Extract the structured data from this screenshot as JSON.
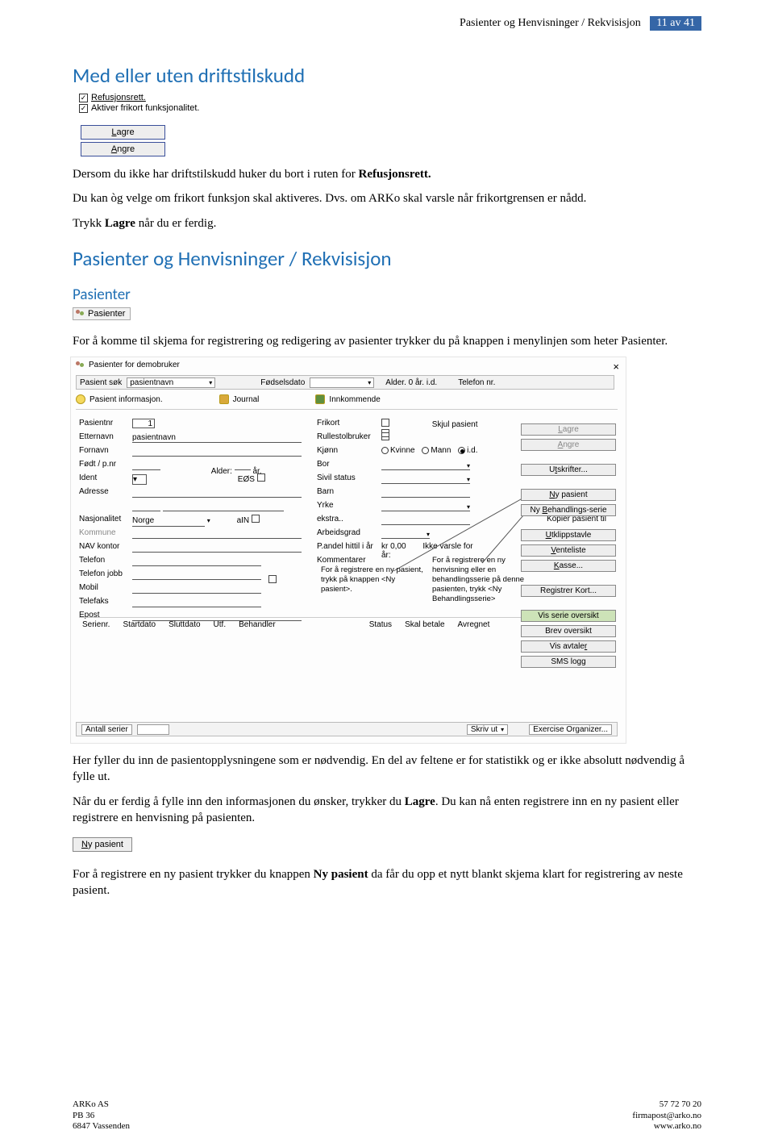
{
  "header": {
    "breadcrumb": "Pasienter og Henvisninger / Rekvisisjon",
    "page_indicator": "11 av 41"
  },
  "h1": "Med eller uten driftstilskudd",
  "checkbox1": {
    "label": "Refusjonsrett."
  },
  "checkbox2": {
    "label": "Aktiver frikort funksjonalitet."
  },
  "btn_lagre": "Lagre",
  "btn_angre": "Angre",
  "p1a": "Dersom du ikke har driftstilskudd huker du bort i ruten for ",
  "p1b": "Refusjonsrett.",
  "p2a": "Du kan òg velge om frikort funksjon skal aktiveres. Dvs. om ARKo skal varsle når frikortgrensen er nådd.",
  "p3a": "Trykk ",
  "p3b": "Lagre",
  "p3c": " når du er ferdig.",
  "h2": "Pasienter og Henvisninger / Rekvisisjon",
  "h3": "Pasienter",
  "chip_pasienter": "Pasienter",
  "p4": "For å komme til skjema for registrering og redigering av pasienter trykker du på knappen i menylinjen som heter Pasienter.",
  "mock": {
    "title": "Pasienter for demobruker",
    "search_label": "Pasient søk",
    "search_combo": "pasientnavn",
    "fodselsdato": "Fødselsdato",
    "alder_hdr": "Alder.  0 år.  i.d.",
    "telefon_hdr": "Telefon nr.",
    "tab_info": "Pasient informasjon.",
    "tab_journal": "Journal",
    "tab_innkommende": "Innkommende",
    "labels_left": [
      "Pasientnr",
      "Etternavn",
      "Fornavn",
      "Født / p.nr",
      "Ident",
      "Adresse",
      "",
      "Nasjonalitet",
      "Kommune",
      "NAV kontor",
      "Telefon",
      "Telefon jobb",
      "Mobil",
      "Telefaks",
      "Epost"
    ],
    "pasientnr_val": "1",
    "etternavn_val": "pasientnavn",
    "alder_lbl": "Alder:",
    "aar_lbl": "år.",
    "eos_lbl": "EØS",
    "norge_val": "Norge",
    "aIN_lbl": "aIN",
    "mid_labels": [
      "Frikort",
      "Rullestolbruker",
      "Kjønn",
      "Bor",
      "Sivil status",
      "Barn",
      "Yrke",
      "ekstra..",
      "Arbeidsgrad",
      "P.andel hittil i år",
      "Kommentarer"
    ],
    "kjonn_kvinne": "Kvinne",
    "kjonn_mann": "Mann",
    "kjonn_id": "i.d.",
    "kr_lbl": "kr 0,00",
    "varsle_lbl": "Ikke varsle for år:",
    "skjul_lbl": "Skjul pasient",
    "note1": "For å registrere en ny pasient, trykk på knappen <Ny pasient>.",
    "note2": "For å registrere en ny henvisning eller en behandlingsserie på denne pasienten, trykk <Ny Behandlingsserie>",
    "kopier": "Kopier pasient til",
    "buttons": [
      "Lagre",
      "Angre",
      "Utskrifter...",
      "Ny pasient",
      "Ny Behandlings-serie",
      "Utklippstavle",
      "Venteliste",
      "Kasse...",
      "Registrer Kort...",
      "Vis serie oversikt",
      "Brev oversikt",
      "Vis avtaler",
      "SMS logg"
    ],
    "serie_headers": [
      "Serienr.",
      "Startdato",
      "Sluttdato",
      "Utf.",
      "Behandler",
      "Status",
      "Skal betale",
      "Avregnet"
    ],
    "bottom_left": "Antall serier",
    "bottom_mid": "Skriv ut",
    "bottom_right": "Exercise Organizer..."
  },
  "p5": "Her fyller du inn de pasientopplysningene som er nødvendig. En del av feltene er for statistikk og er ikke absolutt nødvendig å fylle ut.",
  "p6a": "Når du er ferdig å fylle inn den informasjonen du ønsker, trykker du ",
  "p6b": "Lagre",
  "p6c": ". Du kan nå enten registrere inn en ny pasient eller registrere en henvisning på pasienten.",
  "ny_pasient_btn": "Ny pasient",
  "p7a": "For å registrere en ny pasient trykker du knappen ",
  "p7b": "Ny pasient",
  "p7c": " da får du opp et nytt blankt skjema klart for registrering av neste pasient.",
  "footer": {
    "l1": "ARKo AS",
    "l2": "PB 36",
    "l3": "6847 Vassenden",
    "r1": "57 72 70 20",
    "r2": "firmapost@arko.no",
    "r3": "www.arko.no"
  }
}
